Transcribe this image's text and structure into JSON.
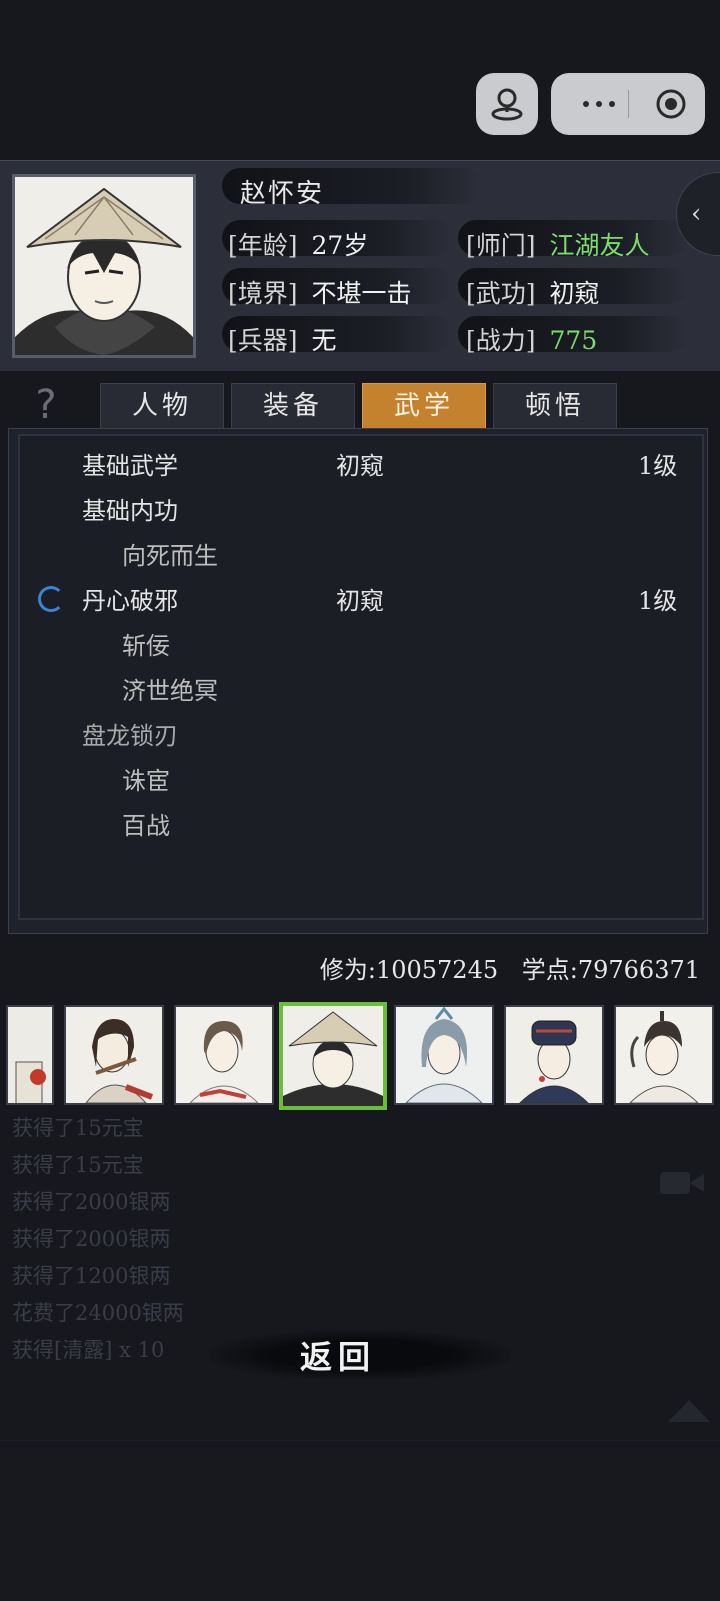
{
  "character": {
    "name": "赵怀安",
    "age_label": "[年龄]",
    "age_value": "27岁",
    "sect_label": "[师门]",
    "sect_value": "江湖友人",
    "realm_label": "[境界]",
    "realm_value": "不堪一击",
    "martial_label": "[武功]",
    "martial_value": "初窥",
    "weapon_label": "[兵器]",
    "weapon_value": "无",
    "power_label": "[战力]",
    "power_value": "775"
  },
  "tabs": [
    {
      "label": "人物",
      "active": false
    },
    {
      "label": "装备",
      "active": false
    },
    {
      "label": "武学",
      "active": true
    },
    {
      "label": "顿悟",
      "active": false
    }
  ],
  "skills": [
    {
      "name": "基础武学",
      "level_text": "初窥",
      "level": "1级"
    },
    {
      "name": "基础内功"
    },
    {
      "name": "向死而生",
      "sub": true
    },
    {
      "name": "丹心破邪",
      "level_text": "初窥",
      "level": "1级",
      "training": true
    },
    {
      "name": "斩佞",
      "sub": true
    },
    {
      "name": "济世绝冥",
      "sub": true
    },
    {
      "name": "盘龙锁刃"
    },
    {
      "name": "诛宦",
      "sub": true
    },
    {
      "name": "百战",
      "sub": true
    }
  ],
  "stats": {
    "cultivation_label": "修为:",
    "cultivation_value": "10057245",
    "points_label": "学点:",
    "points_value": "79766371"
  },
  "log": [
    "获得了15元宝",
    "获得了15元宝",
    "获得了2000银两",
    "获得了2000银两",
    "获得了1200银两",
    "花费了24000银两",
    "获得[清露] x 10"
  ],
  "back_label": "返回",
  "colors": {
    "accent_tab": "#c4822e",
    "highlight_green": "#7ddc6e",
    "selected_border": "#6cbd3a",
    "background": "#16181d"
  }
}
